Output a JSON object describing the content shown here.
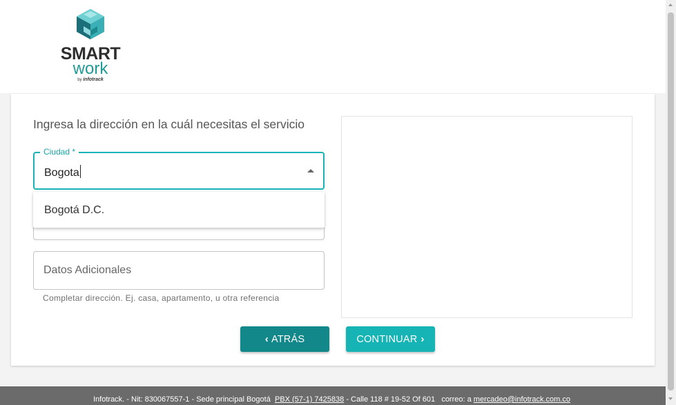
{
  "logo": {
    "word1": "SMART",
    "word2": "work",
    "by": "by",
    "brand": "infotrack"
  },
  "form": {
    "title": "Ingresa la dirección en la cuál necesitas el servicio",
    "ciudad": {
      "label": "Ciudad *",
      "value": "Bogota"
    },
    "dropdown_options": [
      "Bogotá D.C."
    ],
    "datos": {
      "placeholder": "Datos Adicionales",
      "helper": "Completar dirección. Ej. casa, apartamento, u otra referencia"
    }
  },
  "buttons": {
    "back_label": "ATRÁS",
    "next_label": "CONTINUAR"
  },
  "footer": {
    "company": "Infotrack. - Nit: 830067557-1 - Sede principal Bogotá",
    "phone": "PBX (57-1) 7425838",
    "address": "- Calle 118 # 19-52 Of 601",
    "email_prefix": "correo: a",
    "email": "mercadeo@infotrack.com.co"
  },
  "colors": {
    "accent": "#17b4b6",
    "accent_dark": "#13888a",
    "footer_bg": "#6b6b6b"
  }
}
